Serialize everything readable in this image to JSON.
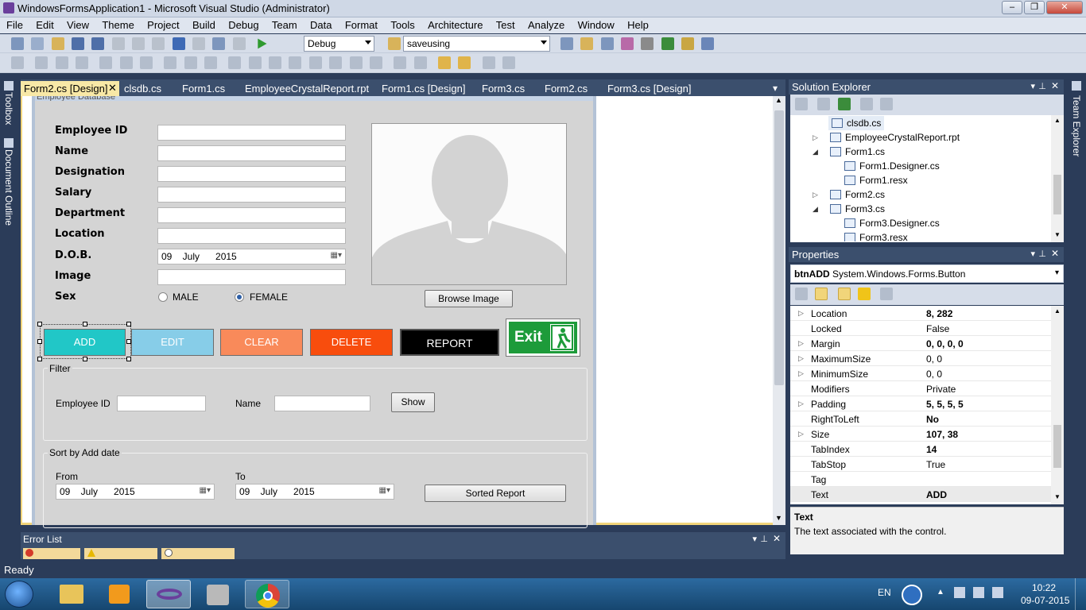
{
  "window": {
    "title": "WindowsFormsApplication1 - Microsoft Visual Studio (Administrator)",
    "minimize": "‒",
    "maximize": "❐",
    "close": "✕"
  },
  "menu": [
    "File",
    "Edit",
    "View",
    "Theme",
    "Project",
    "Build",
    "Debug",
    "Team",
    "Data",
    "Format",
    "Tools",
    "Architecture",
    "Test",
    "Analyze",
    "Window",
    "Help"
  ],
  "toolbar": {
    "config": "Debug",
    "find": "saveusing"
  },
  "left_strip": {
    "toolbox": "Toolbox",
    "doc_outline": "Document Outline"
  },
  "right_strip": {
    "team_explorer": "Team Explorer"
  },
  "tabs": [
    "Form2.cs [Design]",
    "clsdb.cs",
    "Form1.cs",
    "EmployeeCrystalReport.rpt",
    "Form1.cs [Design]",
    "Form3.cs",
    "Form2.cs",
    "Form3.cs [Design]"
  ],
  "form": {
    "title": "Employee Database",
    "fields": {
      "employee_id": "Employee ID",
      "name": "Name",
      "designation": "Designation",
      "salary": "Salary",
      "department": "Department",
      "location": "Location",
      "dob": "D.O.B.",
      "image": "Image",
      "sex": "Sex"
    },
    "dob_value": "09    July      2015",
    "sex_options": {
      "male": "MALE",
      "female": "FEMALE"
    },
    "browse_image": "Browse Image",
    "buttons": {
      "add": "ADD",
      "edit": "EDIT",
      "clear": "CLEAR",
      "delete": "DELETE",
      "report": "REPORT",
      "exit": "Exit"
    },
    "filter": {
      "title": "Filter",
      "employee_id": "Employee ID",
      "name": "Name",
      "show": "Show"
    },
    "sort": {
      "title": "Sort by Add date",
      "from": "From",
      "to": "To",
      "from_value": "09    July      2015",
      "to_value": "09    July      2015",
      "sorted_report": "Sorted Report"
    }
  },
  "solution_explorer": {
    "title": "Solution Explorer",
    "items": [
      "clsdb.cs",
      "EmployeeCrystalReport.rpt",
      "Form1.cs",
      "Form1.Designer.cs",
      "Form1.resx",
      "Form2.cs",
      "Form3.cs",
      "Form3.Designer.cs",
      "Form3.resx"
    ]
  },
  "properties": {
    "title": "Properties",
    "object": "btnADD",
    "object_type": "System.Windows.Forms.Button",
    "rows": [
      {
        "name": "Location",
        "value": "8, 282"
      },
      {
        "name": "Locked",
        "value": "False"
      },
      {
        "name": "Margin",
        "value": "0, 0, 0, 0"
      },
      {
        "name": "MaximumSize",
        "value": "0, 0"
      },
      {
        "name": "MinimumSize",
        "value": "0, 0"
      },
      {
        "name": "Modifiers",
        "value": "Private"
      },
      {
        "name": "Padding",
        "value": "5, 5, 5, 5"
      },
      {
        "name": "RightToLeft",
        "value": "No"
      },
      {
        "name": "Size",
        "value": "107, 38"
      },
      {
        "name": "TabIndex",
        "value": "14"
      },
      {
        "name": "TabStop",
        "value": "True"
      },
      {
        "name": "Tag",
        "value": ""
      },
      {
        "name": "Text",
        "value": "ADD"
      }
    ],
    "desc_title": "Text",
    "desc_text": "The text associated with the control."
  },
  "error_list": {
    "title": "Error List"
  },
  "status": "Ready",
  "tray": {
    "lang": "EN",
    "time": "10:22",
    "date": "09-07-2015"
  },
  "colors": {
    "add": "#21c7c7",
    "edit": "#87cde8",
    "clear": "#f98a5a",
    "delete": "#f84d0d",
    "report": "#000000",
    "exit": "#1d9b3a",
    "vs_dark": "#2b3c59",
    "tab_active": "#f8e8a6"
  }
}
